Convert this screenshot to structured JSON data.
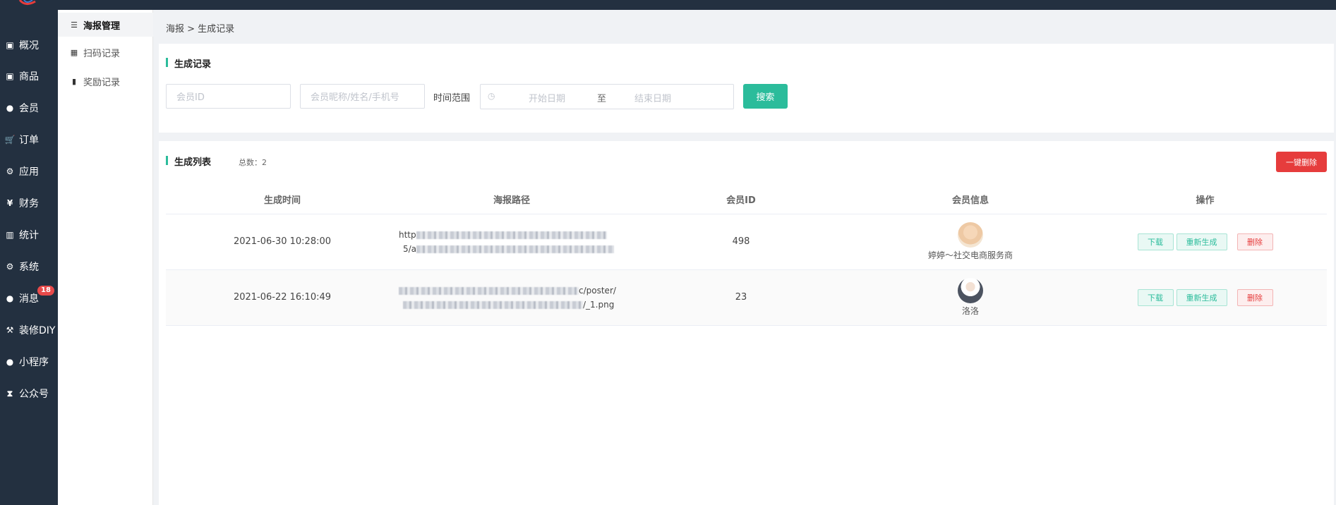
{
  "nav": {
    "items": [
      {
        "label": "概况",
        "icon": "dashboard-icon"
      },
      {
        "label": "商品",
        "icon": "goods-icon"
      },
      {
        "label": "会员",
        "icon": "users-icon"
      },
      {
        "label": "订单",
        "icon": "cart-icon"
      },
      {
        "label": "应用",
        "icon": "apps-icon"
      },
      {
        "label": "财务",
        "icon": "yen-icon"
      },
      {
        "label": "统计",
        "icon": "chart-icon"
      },
      {
        "label": "系统",
        "icon": "gears-icon"
      },
      {
        "label": "消息",
        "icon": "message-icon",
        "badge": "18"
      },
      {
        "label": "装修DIY",
        "icon": "hammer-icon"
      },
      {
        "label": "小程序",
        "icon": "wechat-icon"
      },
      {
        "label": "公众号",
        "icon": "hourglass-icon"
      }
    ]
  },
  "subnav": {
    "items": [
      {
        "label": "海报管理",
        "icon": "list-icon",
        "active": true
      },
      {
        "label": "扫码记录",
        "icon": "qrcode-icon",
        "active": false
      },
      {
        "label": "奖励记录",
        "icon": "bookmark-icon",
        "active": false
      }
    ]
  },
  "breadcrumb": "海报 > 生成记录",
  "filter": {
    "title": "生成记录",
    "member_id_placeholder": "会员ID",
    "member_info_placeholder": "会员昵称/姓名/手机号",
    "time_range_label": "时间范围",
    "start_placeholder": "开始日期",
    "range_separator": "至",
    "end_placeholder": "结束日期",
    "search_label": "搜索"
  },
  "list": {
    "title": "生成列表",
    "total": "总数：2",
    "delete_all_label": "一键删除",
    "columns": [
      "生成时间",
      "海报路径",
      "会员ID",
      "会员信息",
      "操作"
    ],
    "rows": [
      {
        "time": "2021-06-30 10:28:00",
        "path_line1_prefix": "http",
        "path_line2_prefix": "5/a",
        "path_line1_suffix": "",
        "path_line2_suffix": "",
        "member_id": "498",
        "member_name": "婷婷～社交电商服务商",
        "actions": [
          "下载",
          "重新生成",
          "删除"
        ]
      },
      {
        "time": "2021-06-22 16:10:49",
        "path_line1_prefix": "",
        "path_line2_prefix": "",
        "path_line1_suffix": "c/poster/",
        "path_line2_suffix": "/_1.png",
        "member_id": "23",
        "member_name": "洛洛",
        "actions": [
          "下载",
          "重新生成",
          "删除"
        ]
      }
    ]
  },
  "colors": {
    "nav_bg": "#233040",
    "accent": "#2bbc9b",
    "danger": "#e63c3c"
  }
}
